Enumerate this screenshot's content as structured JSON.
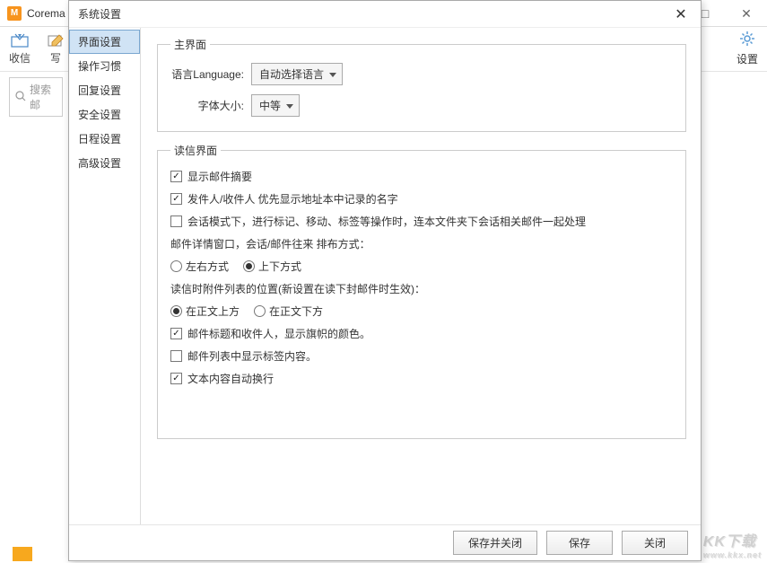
{
  "bg": {
    "title": "Corema",
    "toolbar": {
      "receive": "收信",
      "write": "写"
    },
    "settings": "设置",
    "search_placeholder": "搜索邮"
  },
  "dialog": {
    "title": "系统设置",
    "sidebar": [
      "界面设置",
      "操作习惯",
      "回复设置",
      "安全设置",
      "日程设置",
      "高级设置"
    ],
    "main_section": {
      "legend": "主界面",
      "language_label": "语言Language:",
      "language_value": "自动选择语言",
      "fontsize_label": "字体大小:",
      "fontsize_value": "中等"
    },
    "read_section": {
      "legend": "读信界面",
      "chk_summary": "显示邮件摘要",
      "chk_sender": "发件人/收件人 优先显示地址本中记录的名字",
      "chk_conv": "会话模式下，进行标记、移动、标签等操作时，连本文件夹下会话相关邮件一起处理",
      "layout_label": "邮件详情窗口，会话/邮件往来 排布方式：",
      "radio_lr": "左右方式",
      "radio_ud": "上下方式",
      "attach_label": "读信时附件列表的位置(新设置在读下封邮件时生效)：",
      "radio_above": "在正文上方",
      "radio_below": "在正文下方",
      "chk_flag": "邮件标题和收件人，显示旗帜的颜色。",
      "chk_tags": "邮件列表中显示标签内容。",
      "chk_wrap": "文本内容自动换行"
    },
    "footer": {
      "save_close": "保存并关闭",
      "save": "保存",
      "close": "关闭"
    }
  },
  "watermark": {
    "main": "KK下载",
    "sub": "www.kkx.net"
  }
}
